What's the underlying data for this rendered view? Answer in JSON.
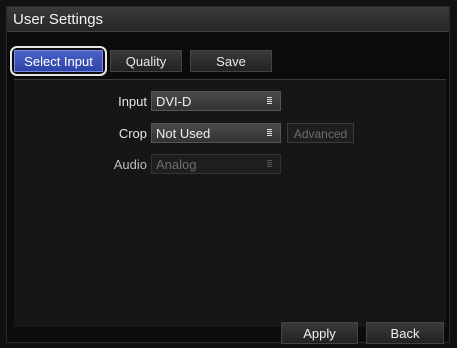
{
  "window": {
    "title": "User Settings"
  },
  "tabs": [
    {
      "label": "Select Input",
      "active": true
    },
    {
      "label": "Quality",
      "active": false
    },
    {
      "label": "Save",
      "active": false
    }
  ],
  "form": {
    "input": {
      "label": "Input",
      "value": "DVI-D"
    },
    "crop": {
      "label": "Crop",
      "value": "Not Used",
      "advanced_label": "Advanced"
    },
    "audio": {
      "label": "Audio",
      "value": "Analog",
      "disabled": true
    }
  },
  "footer": {
    "apply_label": "Apply",
    "back_label": "Back"
  },
  "colors": {
    "active_tab": "#3a52bb",
    "background": "#0b0b0b"
  },
  "icons": {
    "dropdown": "list-glyph-icon"
  }
}
